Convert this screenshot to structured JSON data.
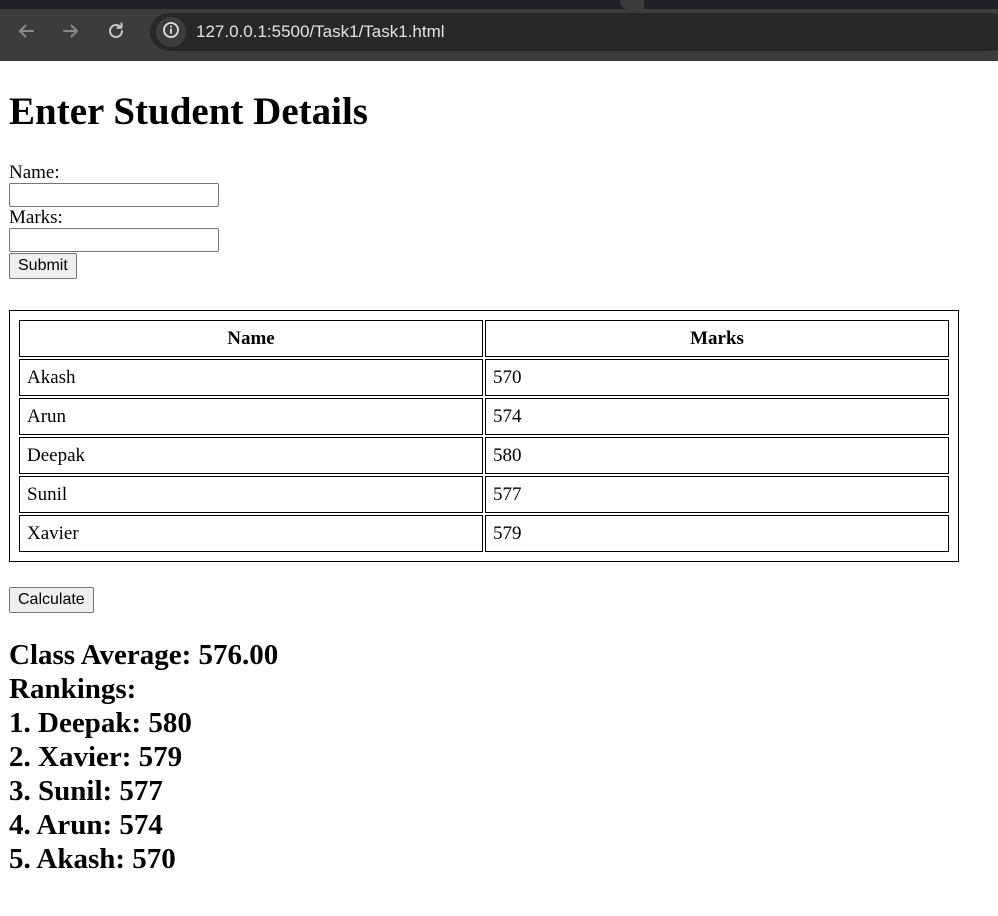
{
  "browser": {
    "url": "127.0.0.1:5500/Task1/Task1.html"
  },
  "page": {
    "heading": "Enter Student Details",
    "form": {
      "name_label": "Name:",
      "name_value": "",
      "marks_label": "Marks:",
      "marks_value": "",
      "submit_label": "Submit"
    },
    "table": {
      "headers": [
        "Name",
        "Marks"
      ],
      "rows": [
        [
          "Akash",
          "570"
        ],
        [
          "Arun",
          "574"
        ],
        [
          "Deepak",
          "580"
        ],
        [
          "Sunil",
          "577"
        ],
        [
          "Xavier",
          "579"
        ]
      ]
    },
    "calculate_label": "Calculate",
    "results": {
      "average": "Class Average: 576.00",
      "rankings_title": "Rankings:",
      "rankings": [
        "1. Deepak: 580",
        "2. Xavier: 579",
        "3. Sunil: 577",
        "4. Arun: 574",
        "5. Akash: 570"
      ]
    }
  }
}
